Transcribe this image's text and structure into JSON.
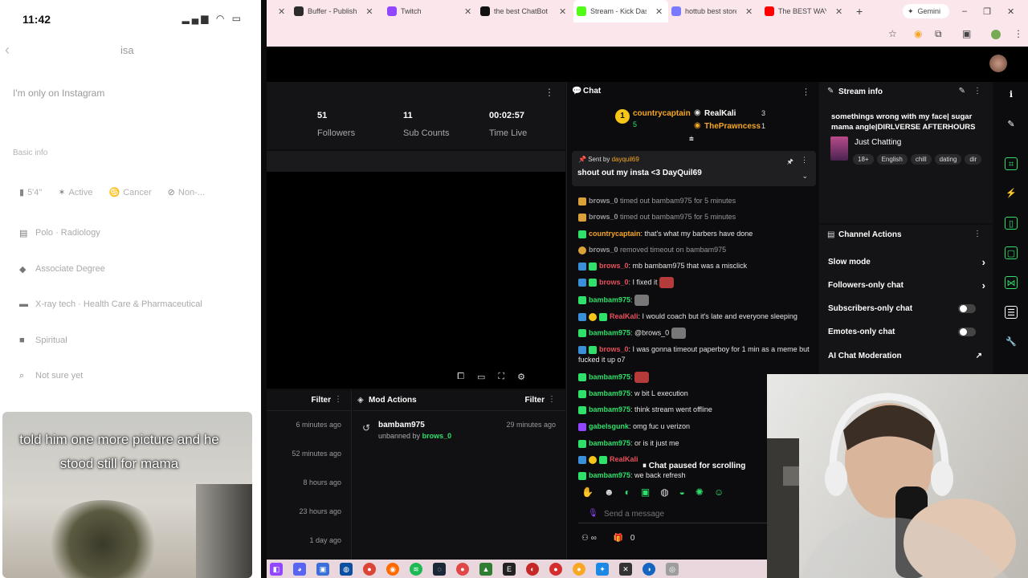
{
  "phone": {
    "time": "11:42",
    "username": "isa",
    "bio": "I'm only on Instagram",
    "section_label": "Basic info",
    "chips": [
      "5'4\"",
      "Active",
      "Cancer",
      "Non-..."
    ],
    "info_items": [
      "Polo · Radiology",
      "Associate Degree",
      "X-ray tech · Health Care & Pharmaceutical",
      "Spiritual",
      "Not sure yet"
    ],
    "video_caption": "told him one more picture and he stood still for mama"
  },
  "browser": {
    "tabs": [
      {
        "label": "Buffer - Publish",
        "color": "#2b2b2b"
      },
      {
        "label": "Twitch",
        "color": "#9146ff"
      },
      {
        "label": "the best ChatBot a",
        "color": "#111111"
      },
      {
        "label": "Stream - Kick Dash",
        "color": "#53fc18",
        "active": true
      },
      {
        "label": "hottub best store",
        "color": "#7a7aff"
      },
      {
        "label": "The BEST WAY to",
        "color": "#ff0000"
      }
    ],
    "gemini_label": "Gemini"
  },
  "stats": {
    "followers_value": "51",
    "followers_label": "Followers",
    "subs_value": "11",
    "subs_label": "Sub Counts",
    "time_value": "00:02:57",
    "time_label": "Time Live"
  },
  "left_panel": {
    "filter_label": "Filter",
    "times": [
      "6 minutes ago",
      "52 minutes ago",
      "8 hours ago",
      "23 hours ago",
      "1 day ago"
    ]
  },
  "mod_actions": {
    "title": "Mod Actions",
    "filter_label": "Filter",
    "entry_user": "bambam975",
    "entry_action": "unbanned by",
    "entry_by": "brows_0",
    "entry_time": "29 minutes ago"
  },
  "chat": {
    "title": "Chat",
    "top_user_1": "countrycaptain",
    "top_user_1_count": "5",
    "top_user_2": "RealKali",
    "top_user_2_count": "3",
    "top_user_3": "ThePrawncess",
    "top_user_3_count": "1",
    "pinned_prefix": "Sent by",
    "pinned_user": "dayquil69",
    "pinned_text": "shout out my insta <3 DayQuil69",
    "messages": [
      {
        "user": "brows_0",
        "text": "timed out bambam975 for 5 minutes",
        "system": true
      },
      {
        "user": "brows_0",
        "text": "timed out bambam975 for 5 minutes",
        "system": true
      },
      {
        "user": "countrycaptain",
        "text": ": that's what my barbers have done",
        "color": "#f5a623"
      },
      {
        "user": "brows_0",
        "text": "removed timeout on bambam975",
        "system": true
      },
      {
        "user": "brows_0",
        "text": ": mb bambam975 that was a misclick",
        "color": "#e8505b"
      },
      {
        "user": "brows_0",
        "text": ": I fixed it",
        "color": "#e8505b",
        "emote": true
      },
      {
        "user": "bambam975",
        "text": ":",
        "color": "#2fe06a",
        "emote": true
      },
      {
        "user": "RealKali",
        "text": ": I would coach but it's late and everyone sleeping",
        "color": "#e8505b"
      },
      {
        "user": "bambam975",
        "text": ": @brows_0",
        "color": "#2fe06a",
        "emote": true
      },
      {
        "user": "brows_0",
        "text": ": I was gonna timeout paperboy for 1 min as a meme but fucked it up o7",
        "color": "#e8505b"
      },
      {
        "user": "bambam975",
        "text": ":",
        "color": "#2fe06a",
        "emote": true
      },
      {
        "user": "bambam975",
        "text": ": w bit L execution",
        "color": "#2fe06a"
      },
      {
        "user": "bambam975",
        "text": ": think stream went offline",
        "color": "#2fe06a"
      },
      {
        "user": "gabelsgunk",
        "text": ": omg fuc u verizon",
        "color": "#2fe06a"
      },
      {
        "user": "bambam975",
        "text": ": or is it just me",
        "color": "#2fe06a"
      },
      {
        "user": "RealKali",
        "text": "",
        "color": "#e8505b"
      },
      {
        "user": "bambam975",
        "text": ": we back refresh",
        "color": "#2fe06a"
      }
    ],
    "paused_label": "Chat paused for scrolling",
    "send_placeholder": "Send a message",
    "footer_count": "0"
  },
  "stream_info": {
    "title": "Stream info",
    "stream_title": "somethings wrong with my face| sugar mama angle|DIRLVERSE AFTERHOURS ...",
    "category": "Just Chatting",
    "tags": [
      "18+",
      "English",
      "chill",
      "dating",
      "dir"
    ]
  },
  "channel_actions": {
    "title": "Channel Actions",
    "items": [
      {
        "label": "Slow mode",
        "kind": "chevron"
      },
      {
        "label": "Followers-only chat",
        "kind": "chevron"
      },
      {
        "label": "Subscribers-only chat",
        "kind": "toggle"
      },
      {
        "label": "Emotes-only chat",
        "kind": "toggle"
      },
      {
        "label": "AI Chat Moderation",
        "kind": "external"
      }
    ]
  },
  "colors": {
    "kick_green": "#53fc18",
    "accent_green": "#2fe06a",
    "name_red": "#e8505b",
    "name_orange": "#f5a623"
  }
}
